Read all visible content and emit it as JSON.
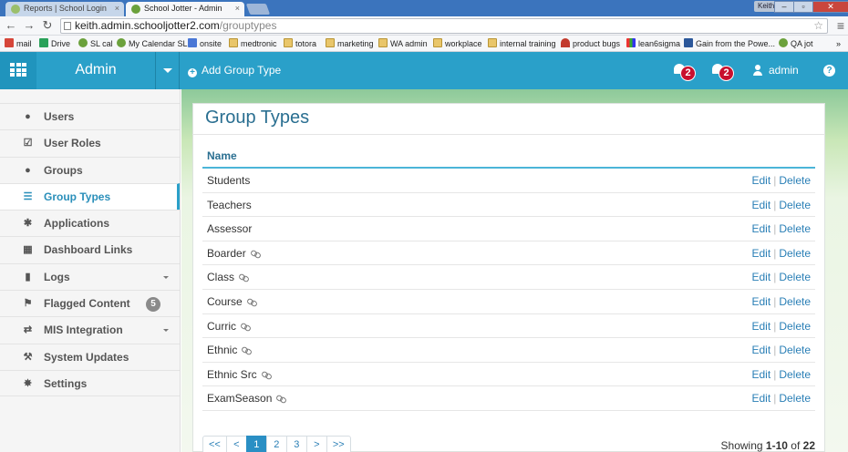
{
  "browser": {
    "tabs": [
      {
        "label": "Reports | School Login",
        "active": false
      },
      {
        "label": "School Jotter - Admin",
        "active": true
      }
    ],
    "user_badge": "Keith",
    "url": {
      "host": "keith.admin.schooljotter2.com",
      "path": "/grouptypes"
    },
    "bookmarks": [
      {
        "label": "mail",
        "icon": "gmail-icon"
      },
      {
        "label": "Drive",
        "icon": "drive-icon"
      },
      {
        "label": "SL cal",
        "icon": "leaf-icon"
      },
      {
        "label": "My Calendar SL",
        "icon": "leaf-icon"
      },
      {
        "label": "onsite",
        "icon": "google-icon"
      },
      {
        "label": "medtronic",
        "icon": "folder-icon"
      },
      {
        "label": "totora",
        "icon": "folder-icon"
      },
      {
        "label": "marketing",
        "icon": "folder-icon"
      },
      {
        "label": "WA admin",
        "icon": "folder-icon"
      },
      {
        "label": "workplace",
        "icon": "folder-icon"
      },
      {
        "label": "internal training",
        "icon": "folder-icon"
      },
      {
        "label": "product bugs",
        "icon": "arch-icon"
      },
      {
        "label": "lean6sigma",
        "icon": "multicolor-icon"
      },
      {
        "label": "Gain from the Powe...",
        "icon": "word-icon"
      },
      {
        "label": "QA jot",
        "icon": "leaf-icon"
      }
    ],
    "bookmarks_more": "»"
  },
  "header": {
    "app_title": "Admin",
    "add_action": "Add Group Type",
    "notifications": [
      {
        "count": "2"
      },
      {
        "count": "2"
      }
    ],
    "username": "admin",
    "help": "?"
  },
  "sidebar": {
    "items": [
      {
        "label": "Users",
        "icon": "user-icon",
        "glyph": "●"
      },
      {
        "label": "User Roles",
        "icon": "checkbox-icon",
        "glyph": "☑"
      },
      {
        "label": "Groups",
        "icon": "users-group-icon",
        "glyph": "●"
      },
      {
        "label": "Group Types",
        "icon": "list-icon",
        "glyph": "☰",
        "active": true
      },
      {
        "label": "Applications",
        "icon": "puzzle-icon",
        "glyph": "✱"
      },
      {
        "label": "Dashboard Links",
        "icon": "grid-icon",
        "glyph": "▦"
      },
      {
        "label": "Logs",
        "icon": "book-icon",
        "glyph": "▮",
        "dropdown": true
      },
      {
        "label": "Flagged Content",
        "icon": "flag-icon",
        "glyph": "⚑",
        "count": "5"
      },
      {
        "label": "MIS Integration",
        "icon": "exchange-icon",
        "glyph": "⇄",
        "dropdown": true
      },
      {
        "label": "System Updates",
        "icon": "wrench-icon",
        "glyph": "⚒"
      },
      {
        "label": "Settings",
        "icon": "gear-icon",
        "glyph": "✸"
      }
    ]
  },
  "main": {
    "page_title": "Group Types",
    "column_name": "Name",
    "edit_label": "Edit",
    "delete_label": "Delete",
    "separator": "|",
    "rows": [
      {
        "name": "Students",
        "linked": false
      },
      {
        "name": "Teachers",
        "linked": false
      },
      {
        "name": "Assessor",
        "linked": false
      },
      {
        "name": "Boarder",
        "linked": true
      },
      {
        "name": "Class",
        "linked": true
      },
      {
        "name": "Course",
        "linked": true
      },
      {
        "name": "Curric",
        "linked": true
      },
      {
        "name": "Ethnic",
        "linked": true
      },
      {
        "name": "Ethnic Src",
        "linked": true
      },
      {
        "name": "ExamSeason",
        "linked": true
      }
    ],
    "pagination": {
      "first": "<<",
      "prev": "<",
      "pages": [
        "1",
        "2",
        "3"
      ],
      "current": "1",
      "next": ">",
      "last": ">>"
    },
    "showing": {
      "prefix": "Showing",
      "range": "1-10",
      "of": "of",
      "total": "22"
    }
  },
  "colors": {
    "header_bg": "#2aa0c9",
    "accent_text": "#2a6f91",
    "link": "#2a7fb6",
    "badge_red": "#c8102e",
    "pager_current": "#2a8fc4"
  }
}
